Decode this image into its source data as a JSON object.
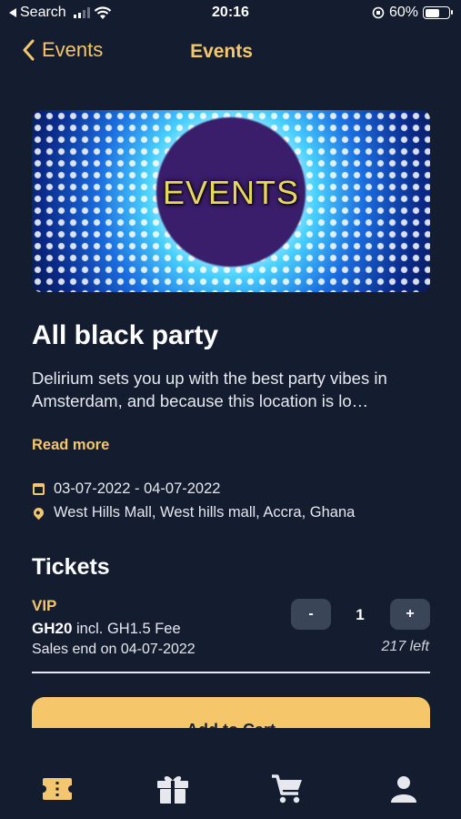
{
  "status_bar": {
    "back_app": "Search",
    "time": "20:16",
    "battery": "60%",
    "battery_level": 0.6
  },
  "nav": {
    "back_label": "Events",
    "title": "Events"
  },
  "banner": {
    "text": "EVENTS"
  },
  "event": {
    "title": "All black party",
    "description": "Delirium sets you up with the best party vibes in Amsterdam, and because this location is lo…",
    "read_more": "Read more",
    "date_range": "03-07-2022 - 04-07-2022",
    "location": "West Hills Mall, West hills mall, Accra, Ghana"
  },
  "tickets": {
    "heading": "Tickets",
    "tiers": [
      {
        "name": "VIP",
        "price": "GH20",
        "fee": "incl. GH1.5 Fee",
        "sales_end": "Sales end on 04-07-2022",
        "quantity": "1",
        "left": "217 left",
        "minus_label": "-",
        "plus_label": "+"
      }
    ]
  },
  "cta": {
    "label": "Add to Cart"
  },
  "bottom_nav": {
    "items": [
      {
        "icon": "ticket-icon",
        "active": true
      },
      {
        "icon": "gift-icon",
        "active": false
      },
      {
        "icon": "cart-icon",
        "active": false
      },
      {
        "icon": "profile-icon",
        "active": false
      }
    ]
  },
  "colors": {
    "background": "#141d30",
    "accent": "#f4c66d",
    "button": "#f6c66a",
    "stepper": "#3a4658"
  }
}
